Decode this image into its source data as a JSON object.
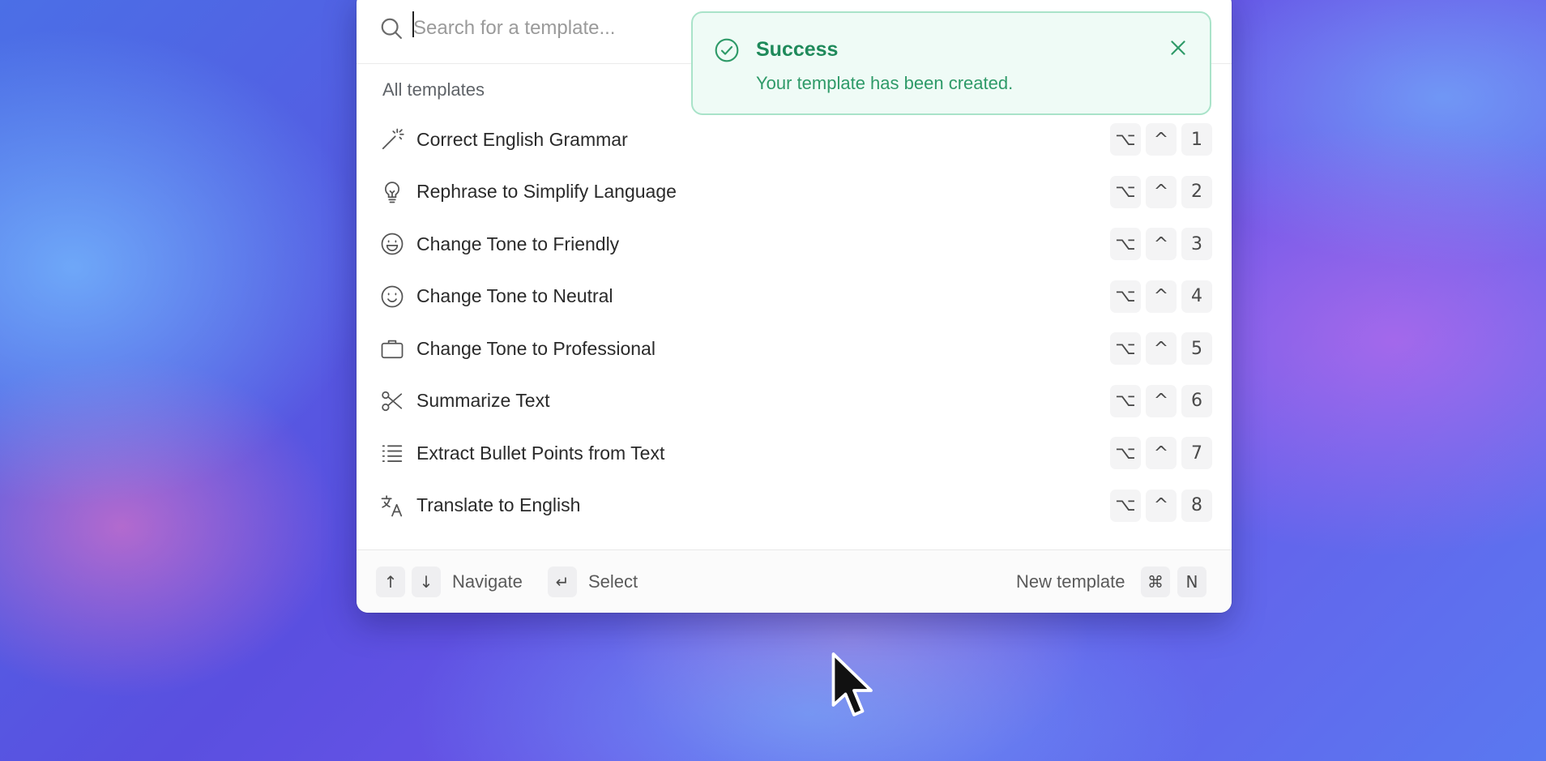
{
  "search": {
    "placeholder": "Search for a template..."
  },
  "section": {
    "title": "All templates"
  },
  "templates": [
    {
      "label": "Correct English Grammar",
      "icon": "magic-wand-icon",
      "keys": [
        "⌥",
        "^",
        "1"
      ]
    },
    {
      "label": "Rephrase to Simplify Language",
      "icon": "lightbulb-icon",
      "keys": [
        "⌥",
        "^",
        "2"
      ]
    },
    {
      "label": "Change Tone to Friendly",
      "icon": "grin-face-icon",
      "keys": [
        "⌥",
        "^",
        "3"
      ]
    },
    {
      "label": "Change Tone to Neutral",
      "icon": "smile-face-icon",
      "keys": [
        "⌥",
        "^",
        "4"
      ]
    },
    {
      "label": "Change Tone to Professional",
      "icon": "briefcase-icon",
      "keys": [
        "⌥",
        "^",
        "5"
      ]
    },
    {
      "label": "Summarize Text",
      "icon": "scissors-icon",
      "keys": [
        "⌥",
        "^",
        "6"
      ]
    },
    {
      "label": "Extract Bullet Points from Text",
      "icon": "bullet-list-icon",
      "keys": [
        "⌥",
        "^",
        "7"
      ]
    },
    {
      "label": "Translate to English",
      "icon": "translate-icon",
      "keys": [
        "⌥",
        "^",
        "8"
      ]
    }
  ],
  "footer": {
    "up_key": "↑",
    "down_key": "↓",
    "navigate_label": "Navigate",
    "enter_key": "↵",
    "select_label": "Select",
    "new_template_label": "New template",
    "cmd_key": "⌘",
    "n_key": "N"
  },
  "toast": {
    "title": "Success",
    "message": "Your template has been created.",
    "icon": "check-circle-icon",
    "close_icon": "close-icon"
  },
  "colors": {
    "toast_bg": "#effbf6",
    "toast_border": "#a9e3c9",
    "toast_title": "#1f8a5b",
    "toast_text": "#2e9a68"
  }
}
